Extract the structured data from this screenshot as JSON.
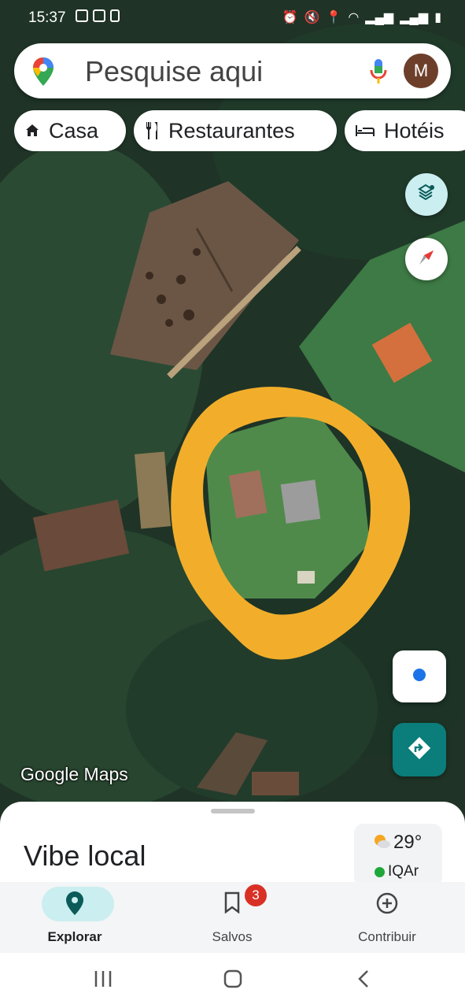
{
  "status_bar": {
    "time": "15:37",
    "left_icons": [
      "gallery-icon",
      "notification-icon",
      "sim-icon"
    ],
    "right_icons": [
      "alarm-icon",
      "mute-icon",
      "location-icon",
      "wifi-icon",
      "signal-icon",
      "signal-icon",
      "battery-icon"
    ]
  },
  "search": {
    "placeholder": "Pesquise aqui",
    "avatar_initial": "M"
  },
  "chips": [
    {
      "label": "Casa",
      "icon": "home-icon"
    },
    {
      "label": "Restaurantes",
      "icon": "restaurant-icon"
    },
    {
      "label": "Hotéis",
      "icon": "hotel-icon"
    }
  ],
  "map": {
    "watermark": "Google Maps",
    "highlight_color": "#f2ae2b",
    "controls": [
      "layers-icon",
      "compass-icon",
      "my-location-icon",
      "directions-icon"
    ]
  },
  "sheet": {
    "title": "Vibe local"
  },
  "weather": {
    "temperature": "29°",
    "air_quality": "IQAr"
  },
  "bottom_nav": {
    "items": [
      {
        "label": "Explorar",
        "icon": "location-pin-icon",
        "active": true
      },
      {
        "label": "Salvos",
        "icon": "bookmark-icon",
        "badge": "3"
      },
      {
        "label": "Contribuir",
        "icon": "add-circle-icon"
      }
    ]
  },
  "colors": {
    "accent_teal": "#0b7d7a",
    "active_pill": "#cbeef0",
    "badge_red": "#d93025",
    "location_blue": "#1a73e8"
  }
}
